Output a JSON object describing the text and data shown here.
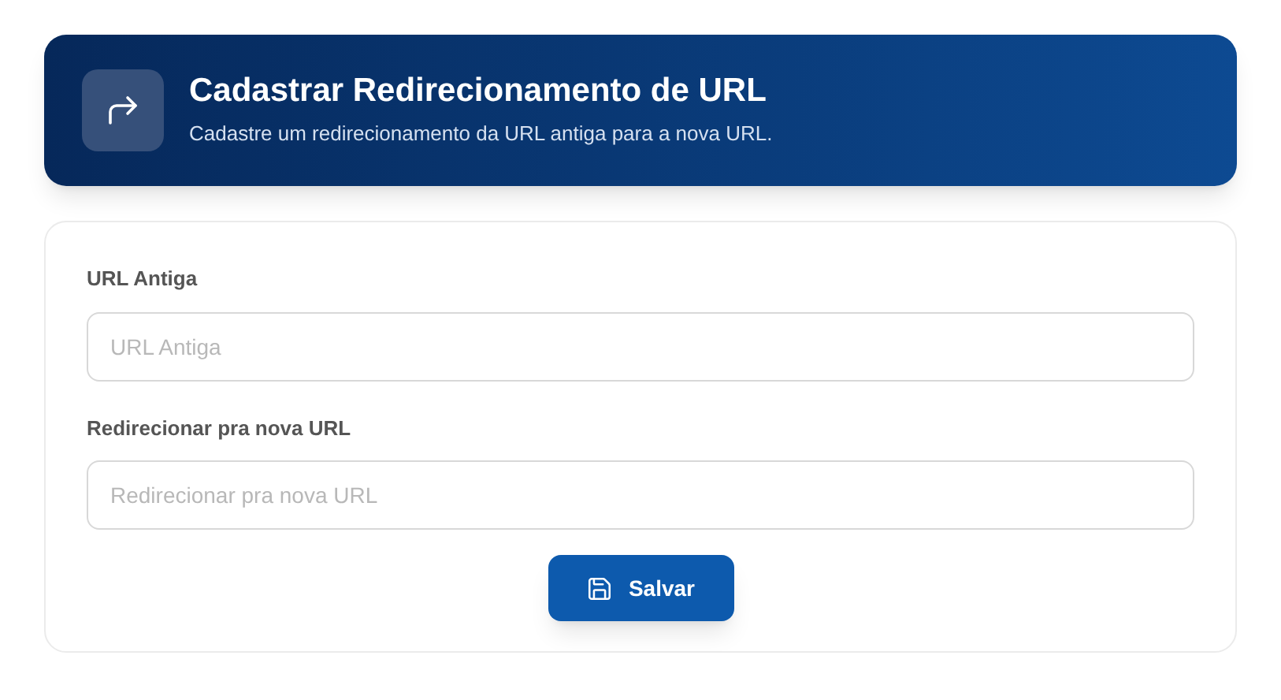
{
  "header": {
    "title": "Cadastrar Redirecionamento de URL",
    "subtitle": "Cadastre um redirecionamento da URL antiga para a nova URL."
  },
  "fields": [
    {
      "label": "URL Antiga",
      "placeholder": "URL Antiga"
    },
    {
      "label": "Redirecionar pra nova URL",
      "placeholder": "Redirecionar pra nova URL"
    }
  ],
  "submit": {
    "label": "Salvar"
  }
}
